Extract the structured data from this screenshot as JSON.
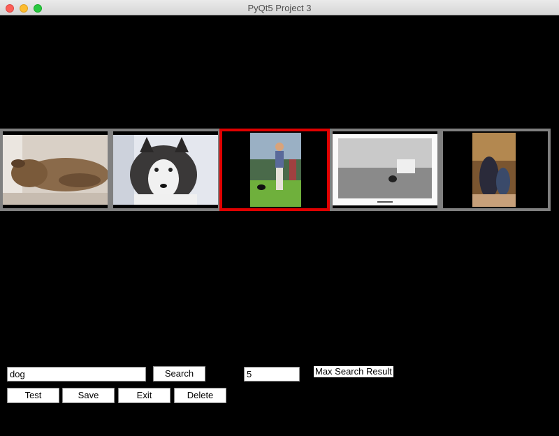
{
  "window": {
    "title": "PyQt5 Project 3"
  },
  "gallery": {
    "selected_index": 2,
    "thumbnails": [
      {
        "description": "dog lying down"
      },
      {
        "description": "husky in snow"
      },
      {
        "description": "person with dog in park"
      },
      {
        "description": "black and white field photo"
      },
      {
        "description": "painting of dog"
      }
    ]
  },
  "controls": {
    "search_query": "dog",
    "search_label": "Search",
    "max_results_value": "5",
    "max_results_label": "Max Search Result",
    "test_label": "Test",
    "save_label": "Save",
    "exit_label": "Exit",
    "delete_label": "Delete"
  },
  "colors": {
    "selected_border": "#e00000",
    "thumb_border": "#808080",
    "background": "#000000"
  }
}
